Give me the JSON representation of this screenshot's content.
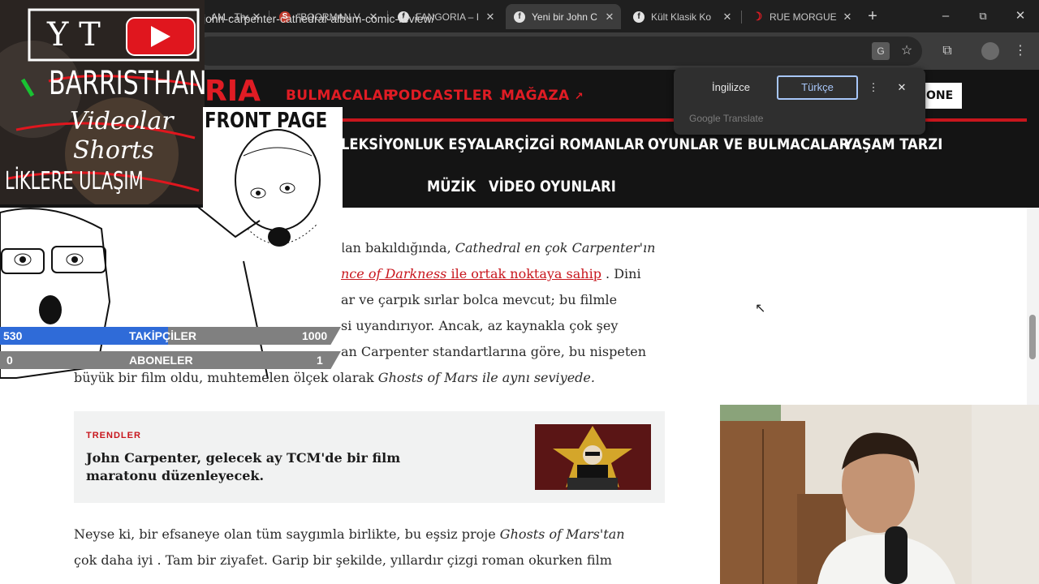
{
  "browser": {
    "tabs": [
      {
        "title": "AM - The",
        "icon": "page-icon",
        "active": false
      },
      {
        "title": "\"BOORMAN V",
        "icon": "site-icon",
        "active": false
      },
      {
        "title": "FANGORIA – I",
        "icon": "facebook-icon",
        "active": false
      },
      {
        "title": "Yeni bir John C",
        "icon": "facebook-icon",
        "active": true
      },
      {
        "title": "Kült Klasik Ko",
        "icon": "facebook-icon",
        "active": false
      },
      {
        "title": "RUE MORGUE",
        "icon": "site-icon",
        "active": false
      }
    ],
    "new_tab": "+",
    "close_glyph": "✕",
    "url": "john-carpenter-cathedral-album-comic-review/"
  },
  "translate": {
    "source_lang": "İngilizce",
    "target_lang": "Türkçe",
    "brand": "Google Translate"
  },
  "site": {
    "logo": "RIA",
    "top_nav": [
      "BULMACALAR",
      "PODCASTLER",
      "MAĞAZA"
    ],
    "done_label": "ONE",
    "main_nav_row1": [
      "LEKSİYONLUK EŞYALAR",
      "ÇİZGİ ROMANLAR",
      "OYUNLAR VE BULMACALAR",
      "YAŞAM TARZI"
    ],
    "main_nav_row2": [
      "MÜZİK",
      "VİDEO OYUNLARI"
    ]
  },
  "article": {
    "p1_l1a": "lan bakıldığında, ",
    "p1_l1b": "Cathedral en çok Carpenter'ın",
    "p1_l2_link": "nce of Darkness",
    "p1_l2_link2": " ile ortak noktaya sahip",
    "p1_l2_rest": " . Dini",
    "p1_l3": "ar ve çarpık sırlar bolca mevcut; bu filmle",
    "p1_l4": "si uyandırıyor. Ancak, az kaynakla çok şey",
    "p1_l5": "an Carpenter standartlarına göre, bu nispeten",
    "p1_l6a": "büyük bir film oldu, muhtemelen ölçek olarak  ",
    "p1_l6b": "Ghosts of Mars ile aynı seviyede.",
    "trend_tag": "TRENDLER",
    "trend_title": "John Carpenter, gelecek ay TCM'de bir film maratonu düzenleyecek.",
    "p2_l1a": "Neyse ki, bir efsaneye olan tüm saygımla birlikte, bu eşsiz proje ",
    "p2_l1b": "Ghosts of Mars'tan",
    "p2_l2": "çok daha iyi . Tam bir ziyafet. Garip bir şekilde, yıllardır çizgi roman okurken film"
  },
  "overlay": {
    "front_page": "FRONT PAGE",
    "scrawl_1": "Y T",
    "scrawl_2": "BARRISTHAN",
    "scrawl_3": "Videolar",
    "scrawl_4": "Shorts",
    "scrawl_5": "LİKLERE ULAŞIM",
    "followers": {
      "label": "TAKİPÇİLER",
      "current": "530",
      "goal": "1000",
      "progress": 0.53
    },
    "subscribers": {
      "label": "ABONELER",
      "current": "0",
      "goal": "1",
      "progress": 0.0
    }
  },
  "colors": {
    "brand_red": "#e01c24",
    "header_bg": "#141414",
    "follow_bar": "#2f6bd8"
  }
}
